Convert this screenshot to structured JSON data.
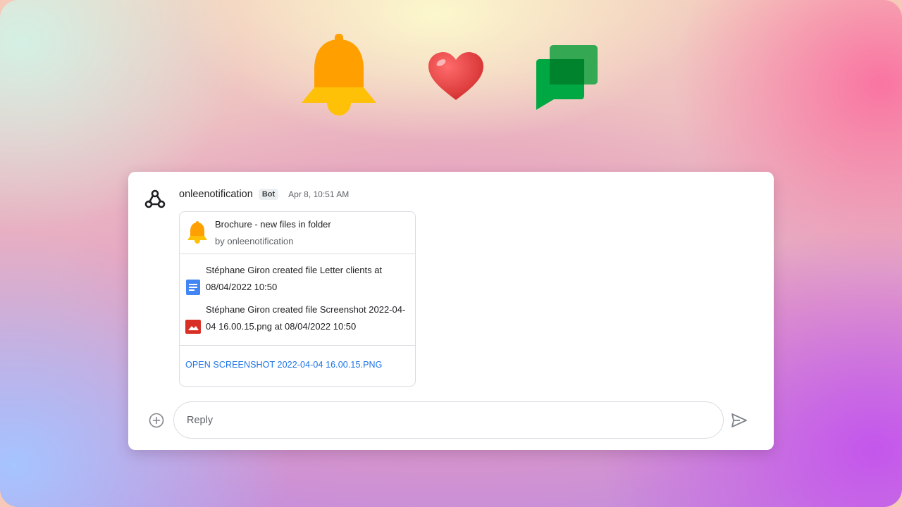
{
  "hero": {
    "bell_icon": "bell-icon",
    "heart_icon": "heart-icon",
    "chat_icon": "google-chat-icon"
  },
  "message": {
    "sender": "onleenotification",
    "badge": "Bot",
    "timestamp": "Apr 8, 10:51 AM",
    "avatar_icon": "webhook-icon",
    "card": {
      "title": "Brochure - new files in folder",
      "subtitle": "by onleenotification",
      "items": [
        {
          "icon": "google-docs-icon",
          "text": "Stéphane Giron created file Letter clients at 08/04/2022 10:50"
        },
        {
          "icon": "image-file-icon",
          "text": "Stéphane Giron created file Screenshot 2022-04-04 16.00.15.png at 08/04/2022 10:50"
        }
      ],
      "action": "OPEN SCREENSHOT 2022-04-04 16.00.15.PNG"
    }
  },
  "composer": {
    "placeholder": "Reply",
    "add_icon": "add-circle-icon",
    "send_icon": "send-icon"
  },
  "colors": {
    "bell_orange": "#ffa000",
    "bell_yellow": "#ffc107",
    "heart_red": "#e53935",
    "chat_green_dark": "#00832d",
    "chat_green_light": "#34a853",
    "link_blue": "#1a73e8",
    "docs_blue": "#4285f4",
    "image_red": "#d93025"
  }
}
